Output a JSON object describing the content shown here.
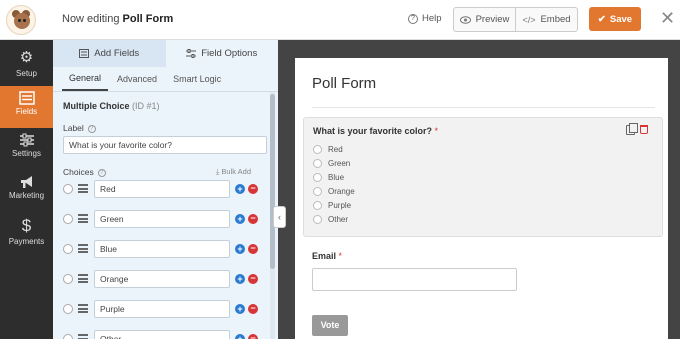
{
  "header": {
    "title_prefix": "Now editing ",
    "form_name": "Poll Form",
    "help_label": "Help",
    "preview_label": "Preview",
    "embed_label": "Embed",
    "save_label": "Save",
    "accent_color": "#e27730"
  },
  "sidebar": {
    "items": [
      {
        "label": "Setup",
        "icon": "gear-icon"
      },
      {
        "label": "Fields",
        "icon": "list-icon",
        "active": true
      },
      {
        "label": "Settings",
        "icon": "sliders-icon"
      },
      {
        "label": "Marketing",
        "icon": "megaphone-icon"
      },
      {
        "label": "Payments",
        "icon": "dollar-icon"
      }
    ]
  },
  "panel": {
    "tabs": [
      {
        "label": "Add Fields",
        "icon": "add-list-icon"
      },
      {
        "label": "Field Options",
        "icon": "sliders-icon",
        "active": true
      }
    ],
    "subtabs": [
      {
        "label": "General",
        "active": true
      },
      {
        "label": "Advanced"
      },
      {
        "label": "Smart Logic"
      }
    ],
    "field_type": "Multiple Choice",
    "field_id": "(ID #1)",
    "label_caption": "Label",
    "label_value": "What is your favorite color?",
    "choices_caption": "Choices",
    "bulk_add": "Bulk Add",
    "choices": [
      "Red",
      "Green",
      "Blue",
      "Orange",
      "Purple",
      "Other"
    ]
  },
  "preview": {
    "form_title": "Poll Form",
    "question": "What is your favorite color?",
    "required_mark": "*",
    "options": [
      "Red",
      "Green",
      "Blue",
      "Orange",
      "Purple",
      "Other"
    ],
    "email_label": "Email",
    "email_required_mark": "*",
    "submit_label": "Vote"
  }
}
